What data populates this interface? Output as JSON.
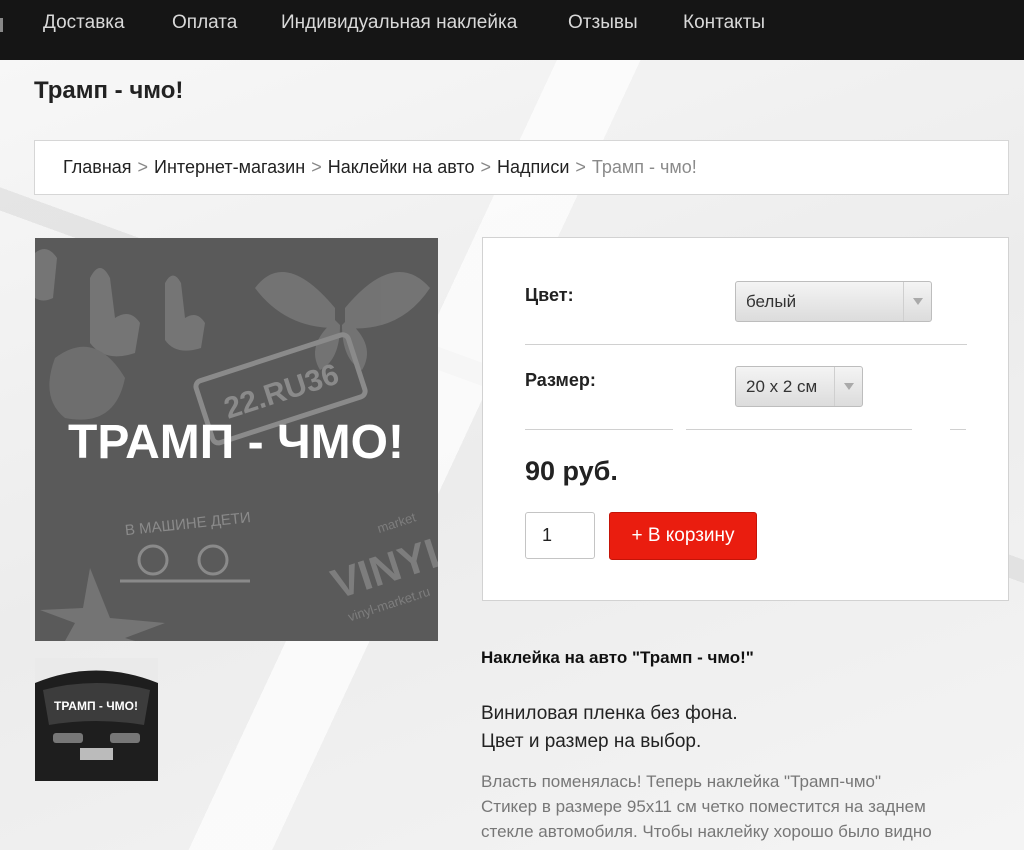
{
  "nav": {
    "items": [
      "Доставка",
      "Оплата",
      "Индивидуальная наклейка",
      "Отзывы",
      "Контакты"
    ]
  },
  "page_title": "Трамп - чмо!",
  "breadcrumb": {
    "items": [
      "Главная",
      "Интернет-магазин",
      "Наклейки на авто",
      "Надписи"
    ],
    "separator": ">",
    "current": "Трамп - чмо!"
  },
  "product_image": {
    "sticker_text": "ТРАМП - ЧМО!",
    "plate_text": "22.RU36",
    "vinyl_text": "VINYL",
    "market_text": "market",
    "kids_text": "В МАШИНЕ ДЕТИ",
    "site_text": "vinyl-market.ru",
    "icon": "sticker-collage-image"
  },
  "thumbnail": {
    "sticker_text": "ТРАМП - ЧМО!",
    "icon": "car-rear-thumbnail"
  },
  "options": {
    "color_label": "Цвет:",
    "color_value": "белый",
    "size_label": "Размер:",
    "size_value": "20 x 2 см",
    "price": "90 руб.",
    "quantity": "1",
    "cart_button": "+ В корзину"
  },
  "description": {
    "title": "Наклейка на авто \"Трамп - чмо!\"",
    "line1": "Виниловая пленка без фона.",
    "line2": "Цвет и размер на выбор.",
    "para1": "Власть поменялась! Теперь наклейка \"Трамп-чмо\"",
    "para2": "Стикер в размере 95x11 см четко поместится на заднем",
    "para3": "стекле автомобиля. Чтобы наклейку хорошо было видно"
  },
  "colors": {
    "nav_bg": "#151515",
    "button_red": "#ea1d0f",
    "image_gray": "#555555"
  }
}
